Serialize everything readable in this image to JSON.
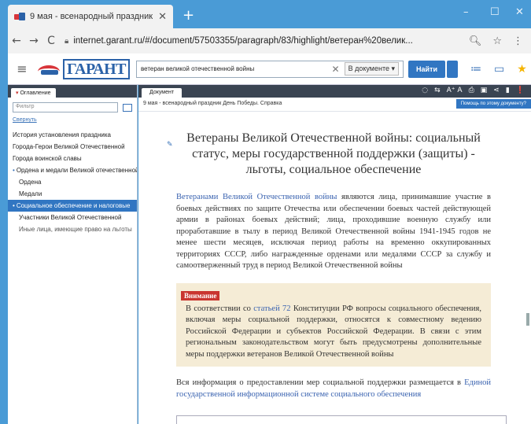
{
  "browser": {
    "tab_title": "9 мая - всенародный праздник",
    "tab_close": "✕",
    "new_tab": "+",
    "controls": {
      "minimize": "–",
      "maximize": "☐",
      "close": "✕"
    },
    "nav": {
      "back": "←",
      "forward": "→",
      "reload": "C"
    },
    "url": "internet.garant.ru/#/document/57503355/paragraph/83/highlight/ветеран%20велик...",
    "url_icons": {
      "zoom": "🔍︎",
      "star": "☆",
      "menu": "⋮"
    }
  },
  "garant": {
    "menu_icon": "≡",
    "logo_text": "ГАРАНТ",
    "search": {
      "value": "ветеран великой отечественной войны",
      "clear": "✕",
      "scope": "В документе ▾"
    },
    "find_label": "Найти",
    "icons": {
      "list": "≔",
      "briefcase": "▭",
      "star": "★"
    }
  },
  "left_panel": {
    "tab_label": "Оглавление",
    "filter_placeholder": "Фильтр",
    "collapse_label": "Свернуть",
    "items": [
      {
        "label": "История установления праздника"
      },
      {
        "label": "Города-Герои Великой Отечественной"
      },
      {
        "label": "Города воинской славы"
      },
      {
        "label": "Ордена и медали Великой отечественной"
      },
      {
        "label": "Ордена"
      },
      {
        "label": "Медали"
      },
      {
        "label": "Социальное обеспечение и налоговые"
      },
      {
        "label": "Участники Великой Отечественной"
      },
      {
        "label": "Иные лица, имеющие право на льготы"
      }
    ]
  },
  "document": {
    "tab_label": "Документ",
    "tools": {
      "bulb": "◌",
      "link": "⇆",
      "font": "A⁺ A",
      "print": "⎙",
      "save": "▣",
      "share": "⋖",
      "bookmark": "▮",
      "info": "❗"
    },
    "breadcrumb": "9 мая - всенародный праздник День Победы. Справка",
    "ask_label": "Помощь по этому документу?",
    "title": "Ветераны Великой Отечественной войны: социальный статус, меры государственной поддержки (защиты) - льготы, социальное обеспечение",
    "para1_link": "Ветеранами Великой Отечественной войны",
    "para1_rest": " являются лица, принимавшие участие в боевых действиях по защите Отечества или обеспечении боевых частей действующей армии в районах боевых действий; лица, проходившие военную службу или проработавшие в тылу в период Великой Отечественной войны 1941-1945 годов не менее шести месяцев, исключая период работы на временно оккупированных территориях СССР, либо награжденные орденами или медалями СССР за службу и самоотверженный труд в период Великой Отечественной войны",
    "attention": {
      "badge": "Внимание",
      "text_before": "В соответствии со ",
      "link": "статьей 72",
      "text_after": " Конституции РФ вопросы социального обеспечения, включая меры социальной поддержки, относятся к совместному ведению Российской Федерации и субъектов Российской Федерации. В связи с этим региональным законодательством могут быть предусмотрены дополнительные меры поддержки ветеранов Великой Отечественной войны"
    },
    "para2_text": "Вся информация о предоставлении мер социальной поддержки размещается в ",
    "para2_link": "Единой государственной информационной системе социального обеспечения"
  }
}
